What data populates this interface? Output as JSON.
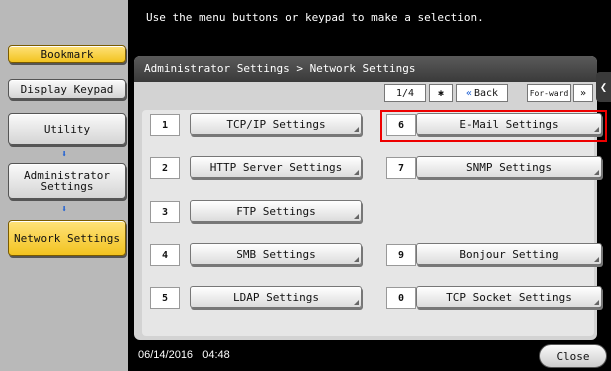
{
  "header": {
    "message": "Use the menu buttons or keypad to make a selection."
  },
  "sidebar": {
    "bookmark": "Bookmark",
    "display_keypad": "Display Keypad",
    "utility": "Utility",
    "administrator_settings": "Administrator Settings",
    "network_settings": "Network Settings"
  },
  "panel": {
    "breadcrumb": "Administrator Settings > Network Settings",
    "page_indicator": "1/4",
    "back_label": "Back",
    "forward_label": "For-ward"
  },
  "settings": [
    {
      "num": "1",
      "label": "TCP/IP Settings"
    },
    {
      "num": "2",
      "label": "HTTP Server Settings"
    },
    {
      "num": "3",
      "label": "FTP Settings"
    },
    {
      "num": "4",
      "label": "SMB Settings"
    },
    {
      "num": "5",
      "label": "LDAP Settings"
    },
    {
      "num": "6",
      "label": "E-Mail Settings"
    },
    {
      "num": "7",
      "label": "SNMP Settings"
    },
    {
      "num": "9",
      "label": "Bonjour Setting"
    },
    {
      "num": "0",
      "label": "TCP Socket Settings"
    }
  ],
  "footer": {
    "date": "06/14/2016",
    "time": "04:48",
    "close_label": "Close"
  },
  "colors": {
    "accent_yellow": "#f2c320",
    "highlight_red": "#e00000",
    "arrow_blue": "#1c5fd4"
  }
}
